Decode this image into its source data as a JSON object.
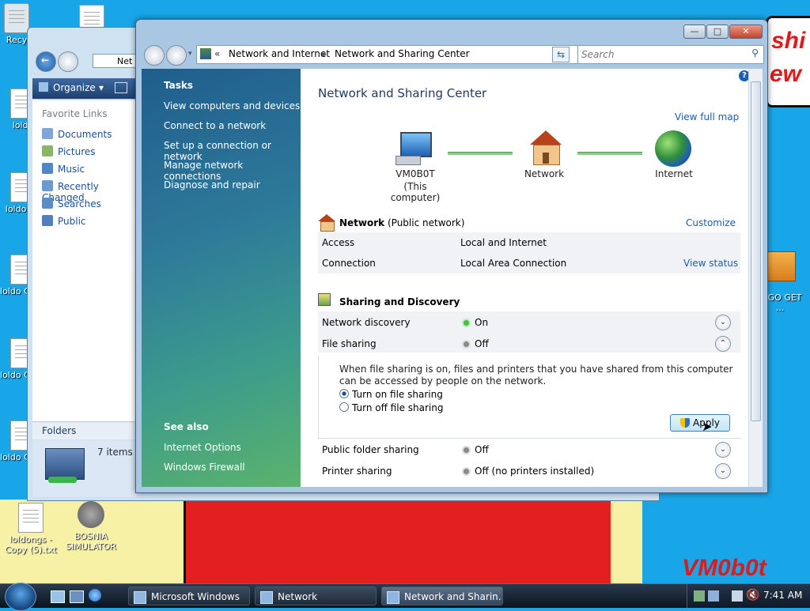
{
  "desktop": {
    "icons": [
      {
        "label": "Recy"
      },
      {
        "label": "loldo"
      },
      {
        "label": "loldo Co"
      },
      {
        "label": "loldo Copy"
      },
      {
        "label": "loldo Copy"
      },
      {
        "label": "loldo Copy"
      },
      {
        "label": "loldongs - Copy (5).txt"
      },
      {
        "label": "BOSNIA SIMULATOR"
      },
      {
        "label": "O GO GET ..."
      }
    ],
    "speech_lines": [
      "shi",
      "ew"
    ],
    "signature": "VM0b0t"
  },
  "back_window": {
    "address_fragment": "Net",
    "toolbar": {
      "organize": "Organize"
    },
    "favorite_links_header": "Favorite Links",
    "favorites": [
      "Documents",
      "Pictures",
      "Music",
      "Recently Changed",
      "Searches",
      "Public"
    ],
    "folders_label": "Folders",
    "item_count": "7 items"
  },
  "main_window": {
    "breadcrumb": [
      "«",
      "Network and Internet",
      "Network and Sharing Center"
    ],
    "search_placeholder": "Search",
    "tasks_header": "Tasks",
    "tasks": [
      "View computers and devices",
      "Connect to a network",
      "Set up a connection or network",
      "Manage network connections",
      "Diagnose and repair"
    ],
    "see_also_header": "See also",
    "see_also": [
      "Internet Options",
      "Windows Firewall"
    ],
    "page_title": "Network and Sharing Center",
    "view_full_map": "View full map",
    "map": {
      "computer_name": "VM0B0T",
      "computer_sub": "(This computer)",
      "network_label": "Network",
      "internet_label": "Internet"
    },
    "network_section": {
      "name": "Network",
      "type": "(Public network)",
      "customize": "Customize",
      "rows": [
        {
          "label": "Access",
          "value": "Local and Internet",
          "link": ""
        },
        {
          "label": "Connection",
          "value": "Local Area Connection",
          "link": "View status"
        }
      ]
    },
    "sharing_section": {
      "title": "Sharing and Discovery",
      "items": [
        {
          "label": "Network discovery",
          "status": "On",
          "status_color": "#3cc43c"
        },
        {
          "label": "File sharing",
          "status": "Off",
          "status_color": "#8a8a8a"
        },
        {
          "label": "Public folder sharing",
          "status": "Off",
          "status_color": "#8a8a8a"
        },
        {
          "label": "Printer sharing",
          "status": "Off (no printers installed)",
          "status_color": "#8a8a8a"
        }
      ],
      "file_sharing_description": "When file sharing is on, files and printers that you have shared from this computer can be accessed by people on the network.",
      "option_on": "Turn on file sharing",
      "option_off": "Turn off file sharing",
      "apply": "Apply"
    }
  },
  "taskbar": {
    "items": [
      "Microsoft Windows",
      "Network",
      "Network and Sharin..."
    ],
    "clock": "7:41 AM"
  }
}
